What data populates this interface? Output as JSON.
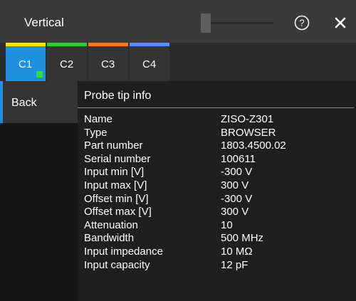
{
  "window": {
    "title": "Vertical",
    "slider_value": 0
  },
  "icons": {
    "help": "help-circle-icon",
    "close": "close-icon"
  },
  "tabs": [
    {
      "label": "C1",
      "color": "#f5e400",
      "active": true
    },
    {
      "label": "C2",
      "color": "#33cc33",
      "active": false
    },
    {
      "label": "C3",
      "color": "#f07820",
      "active": false
    },
    {
      "label": "C4",
      "color": "#5b8cff",
      "active": false
    }
  ],
  "sidebar": {
    "back_label": "Back"
  },
  "probe_info": {
    "title": "Probe tip info",
    "rows": [
      {
        "label": "Name",
        "value": "ZISO-Z301"
      },
      {
        "label": "Type",
        "value": "BROWSER"
      },
      {
        "label": "Part number",
        "value": "1803.4500.02"
      },
      {
        "label": "Serial number",
        "value": "100611"
      },
      {
        "label": "Input min [V]",
        "value": "-300 V"
      },
      {
        "label": "Input max [V]",
        "value": "300 V"
      },
      {
        "label": "Offset min [V]",
        "value": "-300 V"
      },
      {
        "label": "Offset max [V]",
        "value": "300 V"
      },
      {
        "label": "Attenuation",
        "value": "10"
      },
      {
        "label": "Bandwidth",
        "value": "500 MHz"
      },
      {
        "label": "Input impedance",
        "value": "10 MΩ"
      },
      {
        "label": "Input capacity",
        "value": "12 pF"
      }
    ]
  },
  "colors": {
    "accent": "#2090e0",
    "active_indicator": "#33dd33"
  }
}
